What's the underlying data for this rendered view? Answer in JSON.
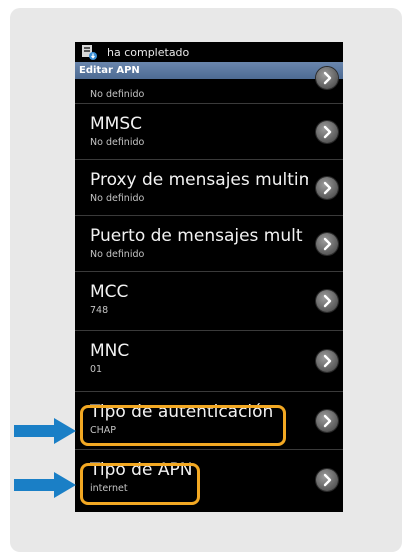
{
  "statusbar": {
    "notification_text": "ha completado",
    "icon": "download-icon"
  },
  "titlebar": {
    "title": "Editar APN"
  },
  "partial_item": {
    "subtitle": "No definido"
  },
  "items": [
    {
      "title": "MMSC",
      "subtitle": "No definido"
    },
    {
      "title": "Proxy de mensajes multim",
      "subtitle": "No definido"
    },
    {
      "title": "Puerto de mensajes mult",
      "subtitle": "No definido"
    },
    {
      "title": "MCC",
      "subtitle": "748"
    },
    {
      "title": "MNC",
      "subtitle": "01"
    },
    {
      "title": "Tipo de autenticación",
      "subtitle": "CHAP"
    },
    {
      "title": "Tipo de APN",
      "subtitle": "internet"
    }
  ],
  "colors": {
    "highlight": "#f2a823",
    "arrow": "#1a7fc6",
    "titlebar": "#5a77a0"
  }
}
